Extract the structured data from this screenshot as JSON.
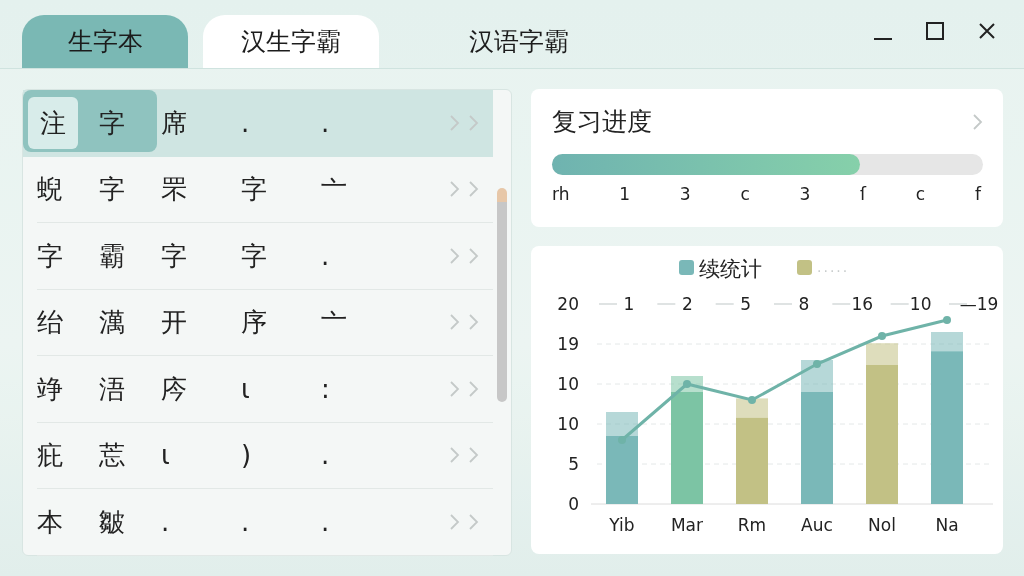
{
  "tabs": [
    {
      "label": "生字本",
      "selected": true,
      "highlighted": false
    },
    {
      "label": "汉生字霸",
      "selected": false,
      "highlighted": true
    },
    {
      "label": "汉语字霸",
      "selected": false,
      "highlighted": false
    }
  ],
  "list": {
    "rows": [
      {
        "selected": true,
        "cells": [
          "注",
          "字",
          "席",
          ".",
          "."
        ]
      },
      {
        "selected": false,
        "cells": [
          "蜺",
          "字",
          "罘",
          "字",
          "亠"
        ]
      },
      {
        "selected": false,
        "cells": [
          "字",
          "霸",
          "字",
          "字",
          "."
        ]
      },
      {
        "selected": false,
        "cells": [
          "绐",
          "澫",
          "开",
          "序",
          "亠"
        ]
      },
      {
        "selected": false,
        "cells": [
          "竫",
          "浯",
          "庈",
          "ɩ",
          ":"
        ]
      },
      {
        "selected": false,
        "cells": [
          "疪",
          "莣",
          "ɩ",
          ")",
          "."
        ]
      },
      {
        "selected": false,
        "cells": [
          "本",
          "皺",
          ".",
          ".",
          "."
        ]
      }
    ]
  },
  "progress": {
    "title": "复习进度",
    "level": 0.715,
    "scale": [
      "rh",
      "1",
      "3",
      "c",
      "3",
      "ſ",
      "c",
      "f"
    ]
  },
  "stats": {
    "legend": [
      {
        "label": "续统计",
        "color": "#7ab8b8"
      },
      {
        "label": "·····",
        "color": "#c2c185"
      }
    ],
    "top_labels": [
      "1",
      "2",
      "5",
      "8",
      "16",
      "10",
      "—19"
    ],
    "y_labels": [
      "20",
      "19",
      "10",
      "10",
      "5",
      "0"
    ],
    "bars": [
      {
        "label": "Yib",
        "color": "#7ab8b8"
      },
      {
        "label": "Mar",
        "color": "#7cc4a4"
      },
      {
        "label": "Rm",
        "color": "#c2c185"
      },
      {
        "label": "Auc",
        "color": "#7ab8b8"
      },
      {
        "label": "Nol",
        "color": "#c2c185"
      },
      {
        "label": "Na",
        "color": "#7ab8b8"
      }
    ]
  }
}
